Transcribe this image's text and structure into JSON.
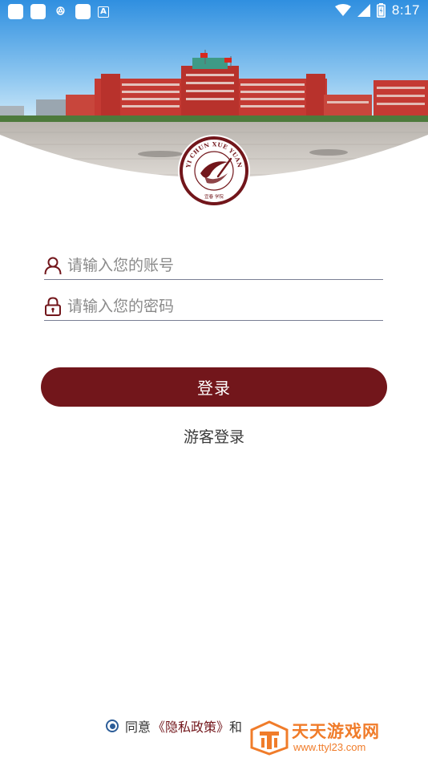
{
  "status_bar": {
    "time": "8:17",
    "app_glyph": "ꔮ",
    "letter_icon": "A",
    "icons": [
      "notification-square-icon",
      "notification-square-icon",
      "app-glyph-icon",
      "notification-square-icon",
      "letter-a-icon",
      "wifi-icon",
      "cellular-signal-icon",
      "battery-icon"
    ]
  },
  "logo": {
    "ring_text": "YI CHUN XUE YUAN",
    "bottom_text": "宜春 学院"
  },
  "form": {
    "account_placeholder": "请输入您的账号",
    "password_placeholder": "请输入您的密码",
    "account_icon": "user-icon",
    "password_icon": "lock-icon"
  },
  "actions": {
    "login_label": "登录",
    "guest_login_label": "游客登录"
  },
  "agreement": {
    "agree_text": "同意",
    "privacy_policy": "《隐私政策》",
    "and_text": "和"
  },
  "watermark": {
    "title": "天天游戏网",
    "url": "www.ttyl23.com"
  },
  "colors": {
    "brand": "#72161b",
    "radio": "#2c5d98",
    "watermark": "#f07c2a"
  }
}
